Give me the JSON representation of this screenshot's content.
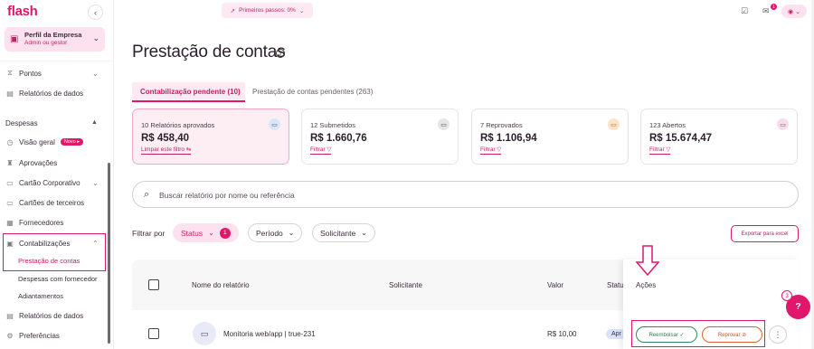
{
  "app": {
    "logo": "flash",
    "collapse_icon": "chevron-left-icon"
  },
  "profile": {
    "name": "Perfil da Empresa",
    "role": "Admin ou gestor"
  },
  "sidebar": {
    "items_top": [
      {
        "label": "Pontos",
        "icon": "clock-icon"
      },
      {
        "label": "Relatórios de dados",
        "icon": "chart-icon"
      }
    ],
    "section_despesas": "Despesas",
    "items": [
      {
        "label": "Visão geral",
        "badge": "Novo"
      },
      {
        "label": "Aprovações"
      },
      {
        "label": "Cartão Corporativo"
      },
      {
        "label": "Cartões de terceiros"
      },
      {
        "label": "Fornecedores"
      },
      {
        "label": "Contabilizações"
      }
    ],
    "sub_items": [
      {
        "label": "Prestação de contas"
      },
      {
        "label": "Despesas com fornecedor"
      },
      {
        "label": "Adiantamentos"
      }
    ],
    "items_bottom": [
      {
        "label": "Relatórios de dados"
      },
      {
        "label": "Preferências"
      }
    ]
  },
  "topbar": {
    "onboarding": "Primeiros passos: 0%",
    "notif_count": "1"
  },
  "page": {
    "title": "Prestação de contas",
    "help": "?"
  },
  "tabs": [
    {
      "label": "Contabilização pendente (10)"
    },
    {
      "label": "Prestação de contas pendentes (263)"
    }
  ],
  "cards": [
    {
      "title": "10 Relatórios aprovados",
      "value": "R$ 458,40",
      "link": "Limpar este filtro ⇆",
      "icon_color": "#dbe6f7"
    },
    {
      "title": "12 Submetidos",
      "value": "R$ 1.660,76",
      "link": "Filtrar ▽",
      "icon_color": "#e6e6e6"
    },
    {
      "title": "7 Reprovados",
      "value": "R$ 1.106,94",
      "link": "Filtrar ▽",
      "icon_color": "#fbe3c8"
    },
    {
      "title": "123 Abertos",
      "value": "R$ 15.674,47",
      "link": "Filtrar ▽",
      "icon_color": "#f8dcea"
    }
  ],
  "search": {
    "placeholder": "Buscar relatório por nome ou referência"
  },
  "filters": {
    "label": "Filtrar por",
    "status": "Status",
    "status_count": "1",
    "period": "Período",
    "requester": "Solicitante",
    "export": "Exportar para excel"
  },
  "table": {
    "headers": {
      "name": "Nome do relatório",
      "requester": "Solicitante",
      "value": "Valor",
      "status": "Statu",
      "actions": "Ações"
    },
    "rows": [
      {
        "name": "Monitoria web/app | true-231",
        "value": "R$ 10,00",
        "status": "Apr"
      }
    ],
    "reimburse": "Reembolsar ✓",
    "reject": "Reprovar ⊘",
    "more": "⋮"
  },
  "chat": {
    "count": "3"
  }
}
